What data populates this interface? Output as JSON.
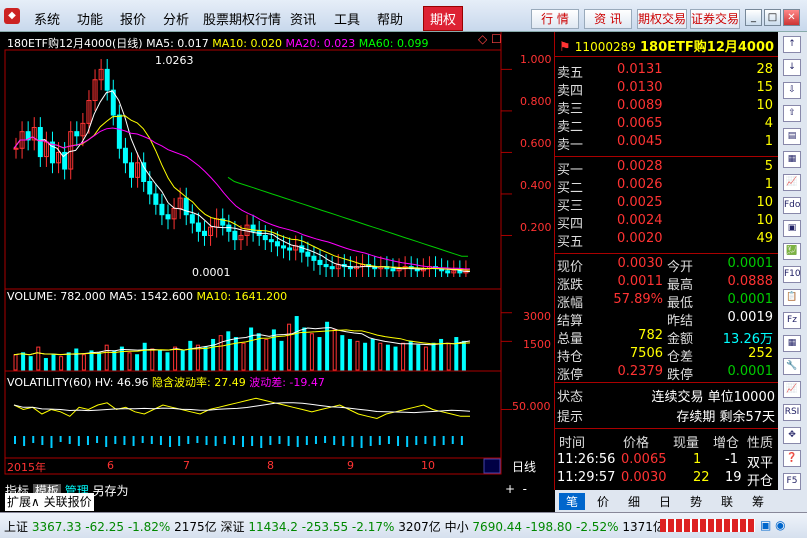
{
  "menu": [
    "系统",
    "功能",
    "报价",
    "分析",
    "股票期权行情",
    "资讯",
    "工具",
    "帮助",
    "期权"
  ],
  "top_buttons": [
    "行 情",
    "资 讯",
    "期权交易",
    "证券交易"
  ],
  "chart_header": {
    "title": "180ETF购12月4000(日线)",
    "ma5": "MA5: 0.017",
    "ma10": "MA10: 0.020",
    "ma20": "MA20: 0.023",
    "ma60": "MA60: 0.099",
    "marker_high": "1.0263",
    "marker_low": "0.0001"
  },
  "price_axis": [
    "1.000",
    "0.800",
    "0.600",
    "0.400",
    "0.200"
  ],
  "volume_header": {
    "volume": "VOLUME: 782.000",
    "ma5": "MA5: 1542.600",
    "ma10": "MA10: 1641.200"
  },
  "volume_axis": [
    "3000",
    "1500"
  ],
  "volatility_header": {
    "title": "VOLATILITY(60)",
    "hv": "HV: 46.96",
    "implied": "隐含波动率: 27.49",
    "spread": "波动差: -19.47"
  },
  "volatility_axis": [
    "50.000"
  ],
  "date_axis": {
    "year": "2015年",
    "months": [
      "6",
      "7",
      "8",
      "9",
      "10"
    ],
    "period": "日线"
  },
  "bottom_tabs": [
    "指标",
    "模板",
    "管理",
    "另存为"
  ],
  "bottom_tabs2": [
    "扩展∧",
    "关联报价"
  ],
  "quote": {
    "code": "11000289",
    "name": "180ETF购12月4000",
    "sells": [
      {
        "label": "卖五",
        "price": "0.0131",
        "vol": "28"
      },
      {
        "label": "卖四",
        "price": "0.0130",
        "vol": "15"
      },
      {
        "label": "卖三",
        "price": "0.0089",
        "vol": "10"
      },
      {
        "label": "卖二",
        "price": "0.0065",
        "vol": "4"
      },
      {
        "label": "卖一",
        "price": "0.0045",
        "vol": "1"
      }
    ],
    "buys": [
      {
        "label": "买一",
        "price": "0.0028",
        "vol": "5"
      },
      {
        "label": "买二",
        "price": "0.0026",
        "vol": "1"
      },
      {
        "label": "买三",
        "price": "0.0025",
        "vol": "10"
      },
      {
        "label": "买四",
        "price": "0.0024",
        "vol": "10"
      },
      {
        "label": "买五",
        "price": "0.0020",
        "vol": "49"
      }
    ],
    "stats": [
      {
        "l1": "现价",
        "v1": "0.0030",
        "l2": "今开",
        "v2": "0.0001",
        "c1": "up",
        "c2": "down"
      },
      {
        "l1": "涨跌",
        "v1": "0.0011",
        "l2": "最高",
        "v2": "0.0888",
        "c1": "up",
        "c2": "up"
      },
      {
        "l1": "涨幅",
        "v1": "57.89%",
        "l2": "最低",
        "v2": "0.0001",
        "c1": "up",
        "c2": "down"
      },
      {
        "l1": "结算",
        "v1": "",
        "l2": "昨结",
        "v2": "0.0019",
        "c1": "wht",
        "c2": "wht"
      },
      {
        "l1": "总量",
        "v1": "782",
        "l2": "金额",
        "v2": "13.26万",
        "c1": "yel",
        "c2": "cyan"
      },
      {
        "l1": "持仓",
        "v1": "7506",
        "l2": "仓差",
        "v2": "252",
        "c1": "yel",
        "c2": "yel"
      },
      {
        "l1": "涨停",
        "v1": "0.2379",
        "l2": "跌停",
        "v2": "0.0001",
        "c1": "up",
        "c2": "down"
      }
    ],
    "state_label": "状态",
    "state_value": "连续交易 单位10000",
    "hint_label": "提示",
    "hint_value": "存续期 剩余57天",
    "trade_headers": [
      "时间",
      "价格",
      "现量",
      "增仓",
      "性质"
    ],
    "trades": [
      {
        "time": "11:26:56",
        "price": "0.0065",
        "qty": "1",
        "oi": "-1",
        "nature": "双平"
      },
      {
        "time": "11:29:57",
        "price": "0.0030",
        "qty": "22",
        "oi": "19",
        "nature": "开仓"
      }
    ],
    "tabs": [
      "笔",
      "价",
      "细",
      "日",
      "势",
      "联",
      "筹"
    ]
  },
  "right_tools": [
    "↑",
    "↓",
    "⇩",
    "⇧",
    "▤",
    "▦",
    "📈",
    "Fdo",
    "▣",
    "💹",
    "F10",
    "📋",
    "Fz",
    "▦",
    "🔧",
    "📈",
    "RSI",
    "✥",
    "❓",
    "F5"
  ],
  "status": {
    "sh_label": "上证",
    "sh": "3367.33",
    "sh_chg": "-62.25",
    "sh_pct": "-1.82%",
    "sh_amt": "2175亿",
    "sz_label": "深证",
    "sz": "11434.2",
    "sz_chg": "-253.55",
    "sz_pct": "-2.17%",
    "sz_amt": "3207亿",
    "zx_label": "中小",
    "zx": "7690.44",
    "zx_chg": "-198.80",
    "zx_pct": "-2.52%",
    "zx_amt": "1371亿"
  },
  "chart_data": {
    "type": "candlestick",
    "title": "180ETF购12月4000(日线)",
    "x_months": [
      "6",
      "7",
      "8",
      "9",
      "10"
    ],
    "ylim": [
      0,
      1.05
    ],
    "close": [
      0.62,
      0.7,
      0.66,
      0.72,
      0.58,
      0.65,
      0.55,
      0.6,
      0.52,
      0.7,
      0.68,
      0.74,
      0.85,
      0.95,
      1.0,
      0.9,
      0.78,
      0.62,
      0.55,
      0.48,
      0.55,
      0.46,
      0.4,
      0.35,
      0.3,
      0.28,
      0.33,
      0.38,
      0.3,
      0.26,
      0.22,
      0.2,
      0.24,
      0.28,
      0.25,
      0.22,
      0.18,
      0.2,
      0.25,
      0.22,
      0.2,
      0.18,
      0.17,
      0.15,
      0.14,
      0.13,
      0.15,
      0.12,
      0.1,
      0.08,
      0.06,
      0.05,
      0.04,
      0.06,
      0.05,
      0.04,
      0.05,
      0.06,
      0.05,
      0.04,
      0.05,
      0.04,
      0.03,
      0.04,
      0.05,
      0.04,
      0.03,
      0.04,
      0.05,
      0.04,
      0.03,
      0.02,
      0.03,
      0.02,
      0.03
    ],
    "ma60": [
      0.48,
      0.46,
      0.45,
      0.44,
      0.43,
      0.42,
      0.41,
      0.4,
      0.39,
      0.38,
      0.37,
      0.36,
      0.35,
      0.34,
      0.33,
      0.32,
      0.31,
      0.3,
      0.29,
      0.28,
      0.27,
      0.26,
      0.25,
      0.24,
      0.23,
      0.22,
      0.21,
      0.2,
      0.19,
      0.18,
      0.17,
      0.16,
      0.15,
      0.14,
      0.13,
      0.12,
      0.11,
      0.1,
      0.1
    ],
    "volume": [
      800,
      900,
      700,
      1200,
      600,
      800,
      700,
      900,
      1100,
      800,
      1000,
      900,
      1300,
      1000,
      1200,
      900,
      800,
      1400,
      1100,
      1000,
      900,
      1200,
      1000,
      1500,
      1300,
      1200,
      1600,
      1800,
      2000,
      1700,
      1400,
      2200,
      1900,
      1600,
      2100,
      1500,
      2400,
      2800,
      2200,
      1900,
      1700,
      2500,
      2100,
      1800,
      1600,
      1500,
      1400,
      1600,
      1400,
      1300,
      1200,
      1400,
      1500,
      1300,
      1200,
      1400,
      1600,
      1400,
      1700,
      1500
    ],
    "hv": [
      52,
      50,
      51,
      48,
      50,
      49,
      47,
      51,
      50,
      52,
      53,
      50,
      51,
      49,
      48,
      50,
      52,
      51,
      50,
      49,
      48,
      50,
      51,
      52,
      53,
      54,
      55,
      54,
      53,
      52,
      51,
      50,
      49,
      50,
      51,
      52,
      50,
      48,
      47,
      46,
      48,
      49,
      50,
      51,
      52,
      50,
      49,
      48,
      47,
      47
    ],
    "iv_bars": [
      8,
      10,
      7,
      9,
      12,
      6,
      8,
      10,
      9,
      7,
      11,
      8,
      9,
      10,
      7,
      8,
      9,
      11,
      10,
      8,
      7,
      9,
      10,
      8,
      9,
      11,
      10,
      12,
      9,
      8,
      10,
      11,
      9,
      8,
      7,
      9,
      10,
      11,
      12,
      10,
      9,
      8,
      10,
      11,
      9,
      8,
      10,
      9,
      8,
      9
    ]
  }
}
